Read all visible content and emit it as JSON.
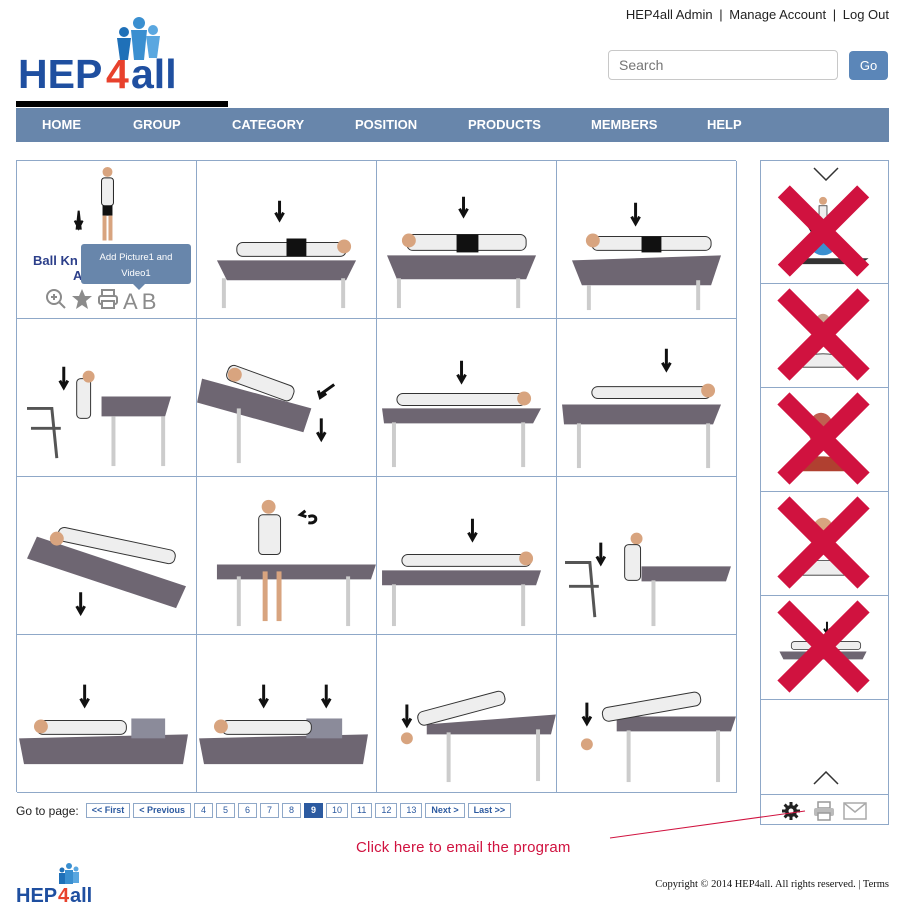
{
  "brand": {
    "logo_text": "HEP4all",
    "small_logo_text": "HEP4all"
  },
  "top_links": {
    "admin": "HEP4all Admin",
    "manage": "Manage Account",
    "logout": "Log Out",
    "separator": "|"
  },
  "search": {
    "placeholder": "Search",
    "go_label": "Go"
  },
  "nav": [
    "HOME",
    "GROUP",
    "CATEGORY",
    "POSITION",
    "PRODUCTS",
    "MEMBERS",
    "HELP"
  ],
  "grid": {
    "first_cell": {
      "title_line1": "Ball Kn",
      "title_line2": "A",
      "tooltip_line1": "Add Picture1 and",
      "tooltip_line2": "Video1",
      "action_a": "A",
      "action_b": "B",
      "icons": [
        "zoom-in-icon",
        "star-icon",
        "print-icon"
      ]
    },
    "exercises": [
      "standing-ball-knee",
      "side-lying-table",
      "side-lying-table-2",
      "supine-table",
      "chair-leaning-table",
      "supine-twist-table",
      "prone-leg-lift",
      "side-lying-leg-lift",
      "supine-leg-drop",
      "seated-rotation",
      "prone-lying",
      "chair-hamstring-stretch",
      "supine-bridge-pillows",
      "supine-bridge-pillows-2",
      "supine-arm-drop",
      "prone-hang-off-table"
    ]
  },
  "right_panel": {
    "up_icon": "chevron-down-icon",
    "down_icon": "chevron-up-icon",
    "items": [
      "standing-on-ball",
      "neck-rotation",
      "neck-muscles",
      "head-neutral",
      "prone-on-table"
    ],
    "footer_icons": [
      "gear-icon",
      "print-icon",
      "email-icon"
    ]
  },
  "pager": {
    "label": "Go to page:",
    "first": "<< First",
    "previous": "< Previous",
    "pages": [
      "4",
      "5",
      "6",
      "7",
      "8",
      "9",
      "10",
      "11",
      "12",
      "13"
    ],
    "current": "9",
    "next": "Next >",
    "last": "Last >>"
  },
  "callout": "Click here to email the program",
  "copyright": "Copyright © 2014 HEP4all. All rights reserved. | Terms",
  "colors": {
    "nav": "#6886ab",
    "brand_blue": "#2c5aa0",
    "accent_red": "#d0123f",
    "border": "#8fa8c8"
  }
}
